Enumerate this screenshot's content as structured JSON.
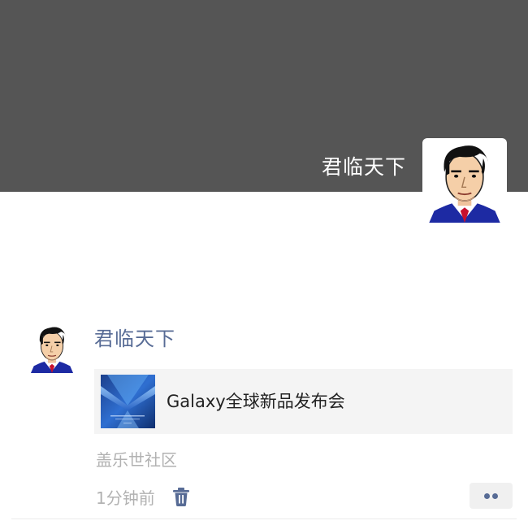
{
  "cover": {
    "user_name": "君临天下",
    "background_color": "#555555"
  },
  "post": {
    "author": "君临天下",
    "shared_link": {
      "title": "Galaxy全球新品发布会"
    },
    "source": "盖乐世社区",
    "time": "1分钟前",
    "author_color": "#576b95",
    "meta_color": "#b2b2b2"
  },
  "icons": {
    "delete": "trash-icon",
    "more": "more-dots-icon",
    "avatar": "cartoon-man-avatar"
  }
}
